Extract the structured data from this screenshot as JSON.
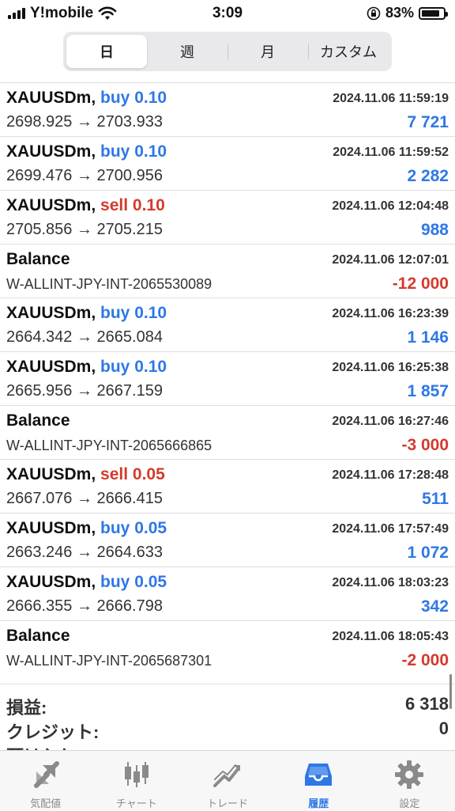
{
  "status_bar": {
    "carrier": "Y!mobile",
    "time": "3:09",
    "battery": "83%"
  },
  "period_tabs": [
    "日",
    "週",
    "月",
    "カスタム"
  ],
  "history": [
    {
      "symbol": "XAUUSDm,",
      "side": "buy",
      "side_label": "buy 0.10",
      "datetime": "2024.11.06 11:59:19",
      "detail": "2698.925 → 2703.933",
      "amount": "7 721",
      "sign": "pos"
    },
    {
      "symbol": "XAUUSDm,",
      "side": "buy",
      "side_label": "buy 0.10",
      "datetime": "2024.11.06 11:59:52",
      "detail": "2699.476 → 2700.956",
      "amount": "2 282",
      "sign": "pos"
    },
    {
      "symbol": "XAUUSDm,",
      "side": "sell",
      "side_label": "sell 0.10",
      "datetime": "2024.11.06 12:04:48",
      "detail": "2705.856 → 2705.215",
      "amount": "988",
      "sign": "pos"
    },
    {
      "symbol": "Balance",
      "side": "",
      "side_label": "",
      "datetime": "2024.11.06 12:07:01",
      "detail": "W-ALLINT-JPY-INT-2065530089",
      "amount": "-12 000",
      "sign": "neg"
    },
    {
      "symbol": "XAUUSDm,",
      "side": "buy",
      "side_label": "buy 0.10",
      "datetime": "2024.11.06 16:23:39",
      "detail": "2664.342 → 2665.084",
      "amount": "1 146",
      "sign": "pos"
    },
    {
      "symbol": "XAUUSDm,",
      "side": "buy",
      "side_label": "buy 0.10",
      "datetime": "2024.11.06 16:25:38",
      "detail": "2665.956 → 2667.159",
      "amount": "1 857",
      "sign": "pos"
    },
    {
      "symbol": "Balance",
      "side": "",
      "side_label": "",
      "datetime": "2024.11.06 16:27:46",
      "detail": "W-ALLINT-JPY-INT-2065666865",
      "amount": "-3 000",
      "sign": "neg"
    },
    {
      "symbol": "XAUUSDm,",
      "side": "sell",
      "side_label": "sell 0.05",
      "datetime": "2024.11.06 17:28:48",
      "detail": "2667.076 → 2666.415",
      "amount": "511",
      "sign": "pos"
    },
    {
      "symbol": "XAUUSDm,",
      "side": "buy",
      "side_label": "buy 0.05",
      "datetime": "2024.11.06 17:57:49",
      "detail": "2663.246 → 2664.633",
      "amount": "1 072",
      "sign": "pos"
    },
    {
      "symbol": "XAUUSDm,",
      "side": "buy",
      "side_label": "buy 0.05",
      "datetime": "2024.11.06 18:03:23",
      "detail": "2666.355 → 2666.798",
      "amount": "342",
      "sign": "pos"
    },
    {
      "symbol": "Balance",
      "side": "",
      "side_label": "",
      "datetime": "2024.11.06 18:05:43",
      "detail": "W-ALLINT-JPY-INT-2065687301",
      "amount": "-2 000",
      "sign": "neg"
    }
  ],
  "summary": [
    {
      "label": "損益:",
      "value": "6 318"
    },
    {
      "label": "クレジット:",
      "value": "0"
    },
    {
      "label": "預け入れ:",
      "value": ""
    }
  ],
  "tabbar": [
    {
      "label": "気配値",
      "icon": "quotes-icon"
    },
    {
      "label": "チャート",
      "icon": "chart-icon"
    },
    {
      "label": "トレード",
      "icon": "trade-icon"
    },
    {
      "label": "履歴",
      "icon": "history-icon",
      "active": true
    },
    {
      "label": "設定",
      "icon": "settings-icon"
    }
  ],
  "colors": {
    "buy": "#2e78e6",
    "sell": "#d43a2c",
    "active_tab": "#2e78e6"
  }
}
